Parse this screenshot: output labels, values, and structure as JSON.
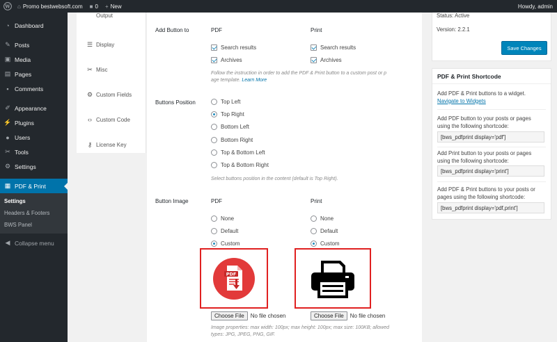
{
  "adminbar": {
    "site_name": "Promo bestwebsoft.com",
    "comments_count": "0",
    "new_label": "New",
    "howdy": "Howdy, admin"
  },
  "sidebar": {
    "items": [
      {
        "label": "Dashboard",
        "icon": "dashboard-icon"
      },
      {
        "label": "Posts",
        "icon": "pin-icon"
      },
      {
        "label": "Media",
        "icon": "media-icon"
      },
      {
        "label": "Pages",
        "icon": "page-icon"
      },
      {
        "label": "Comments",
        "icon": "comment-icon"
      },
      {
        "label": "Appearance",
        "icon": "brush-icon"
      },
      {
        "label": "Plugins",
        "icon": "plugin-icon"
      },
      {
        "label": "Users",
        "icon": "user-icon"
      },
      {
        "label": "Tools",
        "icon": "wrench-icon"
      },
      {
        "label": "Settings",
        "icon": "settings-icon"
      },
      {
        "label": "PDF & Print",
        "icon": "pdf-print-icon"
      }
    ],
    "submenu": [
      "Settings",
      "Headers & Footers",
      "BWS Panel"
    ],
    "collapse": "Collapse menu"
  },
  "tabs": [
    "Output",
    "Display",
    "Misc",
    "Custom Fields",
    "Custom Code",
    "License Key"
  ],
  "main": {
    "add_button": {
      "label": "Add Button to",
      "pdf_head": "PDF",
      "print_head": "Print",
      "search_results": "Search results",
      "archives": "Archives",
      "hint": "Follow the instruction in order to add the PDF & Print button to a custom post or p",
      "hint2": "age template.",
      "learn_more": "Learn More"
    },
    "position": {
      "label": "Buttons Position",
      "options": [
        "Top Left",
        "Top Right",
        "Bottom Left",
        "Bottom Right",
        "Top & Bottom Left",
        "Top & Bottom Right"
      ],
      "selected": 1,
      "hint": "Select buttons position in the content (default is Top Right)."
    },
    "image": {
      "label": "Button Image",
      "pdf_head": "PDF",
      "print_head": "Print",
      "options": [
        "None",
        "Default",
        "Custom"
      ],
      "choose_file": "Choose File",
      "no_file": "No file chosen",
      "pdf_icon_text": "PDF",
      "hint1": "Image properties: max width: 100px; max height: 100px; max size: 100KB; allowed",
      "hint2": "types: JPG, JPEG, PNG, GIF."
    }
  },
  "status": {
    "status": "Status: Active",
    "version": "Version: 2.2.1",
    "save": "Save Changes"
  },
  "shortcode": {
    "title": "PDF & Print Shortcode",
    "widget_text": "Add PDF & Print buttons to a widget.",
    "widget_link": "Navigate to Widgets",
    "pdf_text1": "Add PDF button to your posts or pages",
    "pdf_text2": "using the following shortcode:",
    "pdf_code": "[bws_pdfprint display='pdf']",
    "print_text1": "Add Print button to your posts or pages",
    "print_text2": "using the following shortcode:",
    "print_code": "[bws_pdfprint display='print']",
    "both_text1": "Add PDF & Print buttons to your posts or",
    "both_text2": "pages using the following shortcode:",
    "both_code": "[bws_pdfprint display='pdf,print']"
  },
  "colors": {
    "admin_dark": "#23282d",
    "accent_blue": "#0073aa",
    "highlight_red": "#e02020",
    "pdf_icon_red": "#e23a3a"
  }
}
